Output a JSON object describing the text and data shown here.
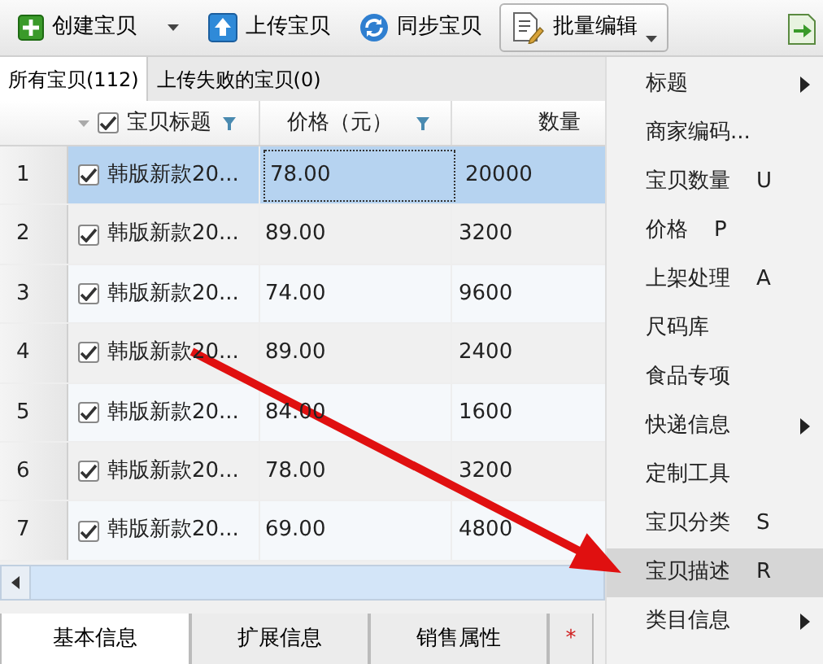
{
  "toolbar": {
    "buttons": [
      {
        "label": "创建宝贝",
        "kind": "create",
        "dropdown": true,
        "selected": false
      },
      {
        "label": "上传宝贝",
        "kind": "upload",
        "dropdown": false,
        "selected": false
      },
      {
        "label": "同步宝贝",
        "kind": "sync",
        "dropdown": false,
        "selected": false
      },
      {
        "label": "批量编辑",
        "kind": "batch",
        "dropdown": true,
        "selected": true
      }
    ]
  },
  "tabs": [
    {
      "label": "所有宝贝(112)",
      "selected": true
    },
    {
      "label": "上传失败的宝贝(0)",
      "selected": false
    }
  ],
  "table": {
    "select_all_checked": true,
    "columns": [
      "宝贝标题",
      "价格（元）",
      "数量"
    ],
    "rows": [
      {
        "index": "1",
        "checked": true,
        "title": "韩版新款20...",
        "price": "78.00",
        "quantity": "20000",
        "selected": true
      },
      {
        "index": "2",
        "checked": true,
        "title": "韩版新款20...",
        "price": "89.00",
        "quantity": "3200",
        "selected": false
      },
      {
        "index": "3",
        "checked": true,
        "title": "韩版新款20...",
        "price": "74.00",
        "quantity": "9600",
        "selected": false
      },
      {
        "index": "4",
        "checked": true,
        "title": "韩版新款20...",
        "price": "89.00",
        "quantity": "2400",
        "selected": false
      },
      {
        "index": "5",
        "checked": true,
        "title": "韩版新款20...",
        "price": "84.00",
        "quantity": "1600",
        "selected": false
      },
      {
        "index": "6",
        "checked": true,
        "title": "韩版新款20...",
        "price": "78.00",
        "quantity": "3200",
        "selected": false
      },
      {
        "index": "7",
        "checked": true,
        "title": "韩版新款20...",
        "price": "69.00",
        "quantity": "4800",
        "selected": false
      }
    ]
  },
  "bottom_tabs": [
    {
      "label": "基本信息",
      "selected": true
    },
    {
      "label": "扩展信息",
      "selected": false
    },
    {
      "label": "销售属性",
      "selected": false
    }
  ],
  "required_mark": "*",
  "menu": {
    "items": [
      {
        "label": "标题",
        "submenu": true,
        "selected": false
      },
      {
        "label": "商家编码...",
        "submenu": false,
        "selected": false
      },
      {
        "label": "宝贝数量",
        "shortcut": "U",
        "submenu": false,
        "selected": false
      },
      {
        "label": "价格",
        "shortcut": "P",
        "submenu": false,
        "selected": false
      },
      {
        "label": "上架处理",
        "shortcut": "A",
        "submenu": false,
        "selected": false
      },
      {
        "label": "尺码库",
        "submenu": false,
        "selected": false
      },
      {
        "label": "食品专项",
        "submenu": false,
        "selected": false
      },
      {
        "label": "快递信息",
        "submenu": true,
        "selected": false
      },
      {
        "label": "定制工具",
        "submenu": false,
        "selected": false
      },
      {
        "label": "宝贝分类",
        "shortcut": "S",
        "submenu": false,
        "selected": false
      },
      {
        "label": "宝贝描述",
        "shortcut": "R",
        "submenu": false,
        "selected": true
      },
      {
        "label": "类目信息",
        "submenu": true,
        "selected": false
      }
    ]
  }
}
